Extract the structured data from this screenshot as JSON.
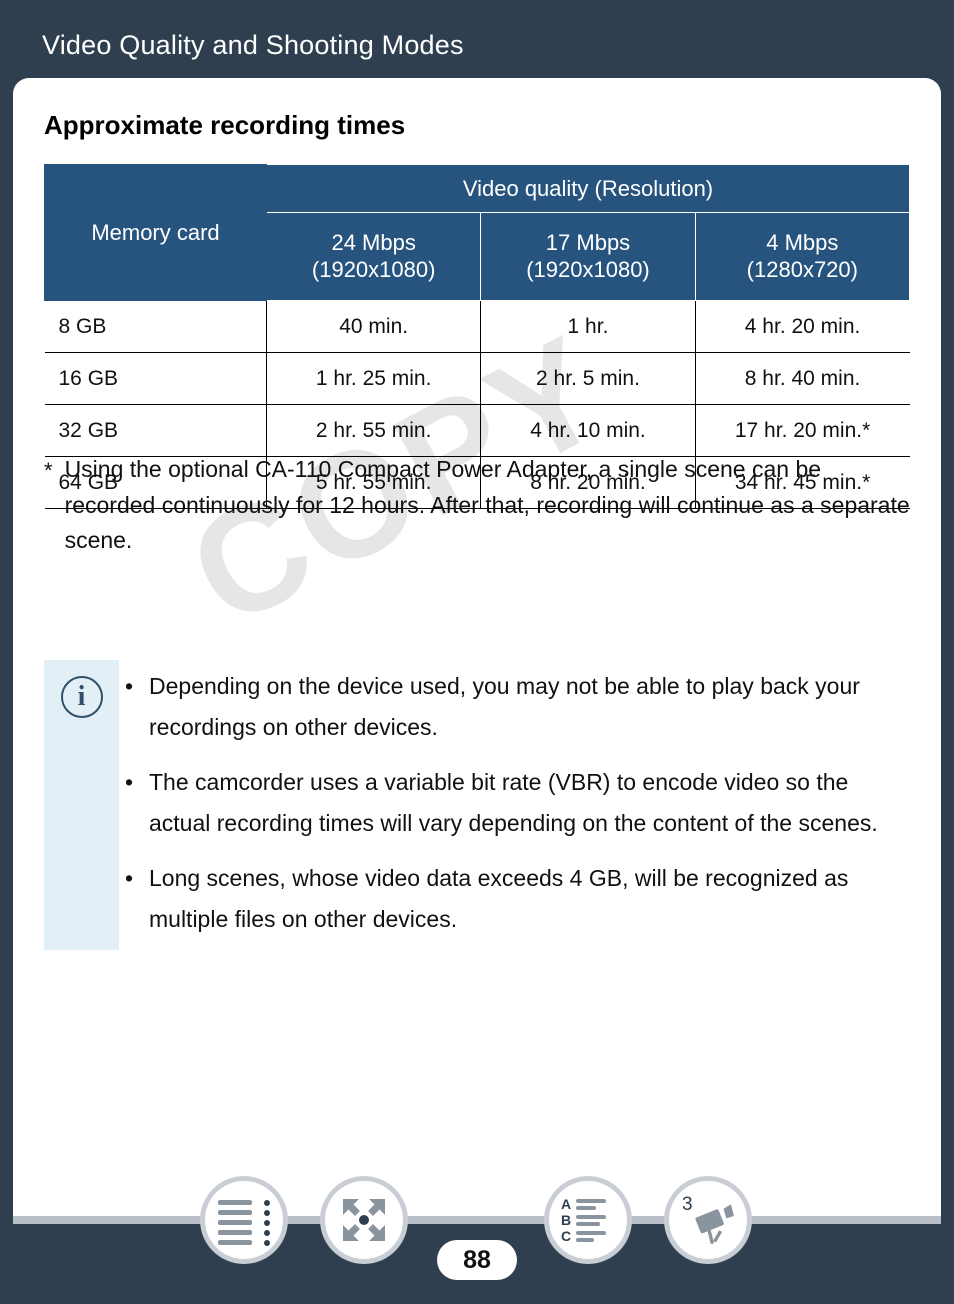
{
  "header": {
    "title": "Video Quality and Shooting Modes"
  },
  "section": {
    "title": "Approximate recording times"
  },
  "watermark": {
    "text": "COPY"
  },
  "table": {
    "corner_header": "Memory card",
    "group_header": "Video quality (Resolution)",
    "columns": [
      {
        "rate": "24 Mbps",
        "resolution": "(1920x1080)"
      },
      {
        "rate": "17 Mbps",
        "resolution": "(1920x1080)"
      },
      {
        "rate": "4 Mbps",
        "resolution": "(1280x720)"
      }
    ],
    "rows": [
      {
        "card": "8 GB",
        "c1": "40 min.",
        "c2": "1 hr.",
        "c3": "4 hr. 20 min."
      },
      {
        "card": "16 GB",
        "c1": "1 hr. 25 min.",
        "c2": "2 hr. 5 min.",
        "c3": "8 hr. 40 min."
      },
      {
        "card": "32 GB",
        "c1": "2 hr. 55 min.",
        "c2": "4 hr. 10 min.",
        "c3": "17 hr. 20 min.*"
      },
      {
        "card": "64 GB",
        "c1": "5 hr. 55 min.",
        "c2": "8 hr. 20 min.",
        "c3": "34 hr. 45 min.*"
      }
    ]
  },
  "footnote": {
    "mark": "*",
    "text": "Using the optional CA-110 Compact Power Adapter, a single scene can be recorded continuously for 12 hours. After that, recording will continue as a separate scene."
  },
  "note": {
    "icon": "info-icon",
    "icon_glyph": "i",
    "bullets": [
      "Depending on the device used, you may not be able to play back your recordings on other devices.",
      "The camcorder uses a variable bit rate (VBR) to encode video so the actual recording times will vary depending on the content of the scenes.",
      "Long scenes, whose video data exceeds 4 GB, will be recognized as multiple files on other devices."
    ]
  },
  "footer": {
    "page_number": "88",
    "buttons": [
      {
        "name": "table-of-contents-icon",
        "label": ""
      },
      {
        "name": "expand-arrows-icon",
        "label": ""
      },
      {
        "name": "alphabetical-index-icon",
        "label": ""
      },
      {
        "name": "chapter-camcorder-icon",
        "label": "3"
      }
    ]
  },
  "colors": {
    "background": "#2f3f4f",
    "table_header": "#27547e",
    "note_bar": "#e3eff7",
    "info_accent": "#2f5068",
    "footer_bar": "#b9bfc6"
  }
}
